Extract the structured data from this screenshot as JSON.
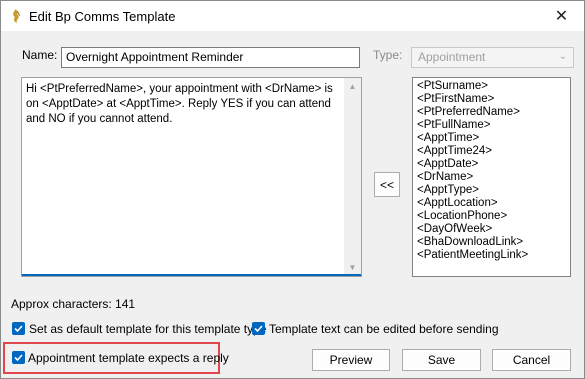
{
  "window": {
    "title": "Edit Bp Comms Template",
    "close_glyph": "✕"
  },
  "form": {
    "name_label": "Name:",
    "name_value": "Overnight Appointment Reminder",
    "type_label": "Type:",
    "type_value": "Appointment",
    "body_text": "Hi <PtPreferredName>, your appointment with <DrName> is on <ApptDate> at <ApptTime>. Reply YES if you can attend and NO if you cannot attend.",
    "approx_chars": "Approx characters: 141"
  },
  "fields_list": [
    "<PtSurname>",
    "<PtFirstName>",
    "<PtPreferredName>",
    "<PtFullName>",
    "<ApptTime>",
    "<ApptTime24>",
    "<ApptDate>",
    "<DrName>",
    "<ApptType>",
    "<ApptLocation>",
    "<LocationPhone>",
    "<DayOfWeek>",
    "<BhaDownloadLink>",
    "<PatientMeetingLink>"
  ],
  "insert_button": "<<",
  "options": {
    "default_template": "Set as default template for this template type",
    "editable": "Template text can be edited before sending",
    "expects_reply": "Appointment template expects a reply"
  },
  "buttons": {
    "preview": "Preview",
    "save": "Save",
    "cancel": "Cancel"
  },
  "colors": {
    "accent": "#0067c0",
    "highlight": "#e0474c"
  }
}
